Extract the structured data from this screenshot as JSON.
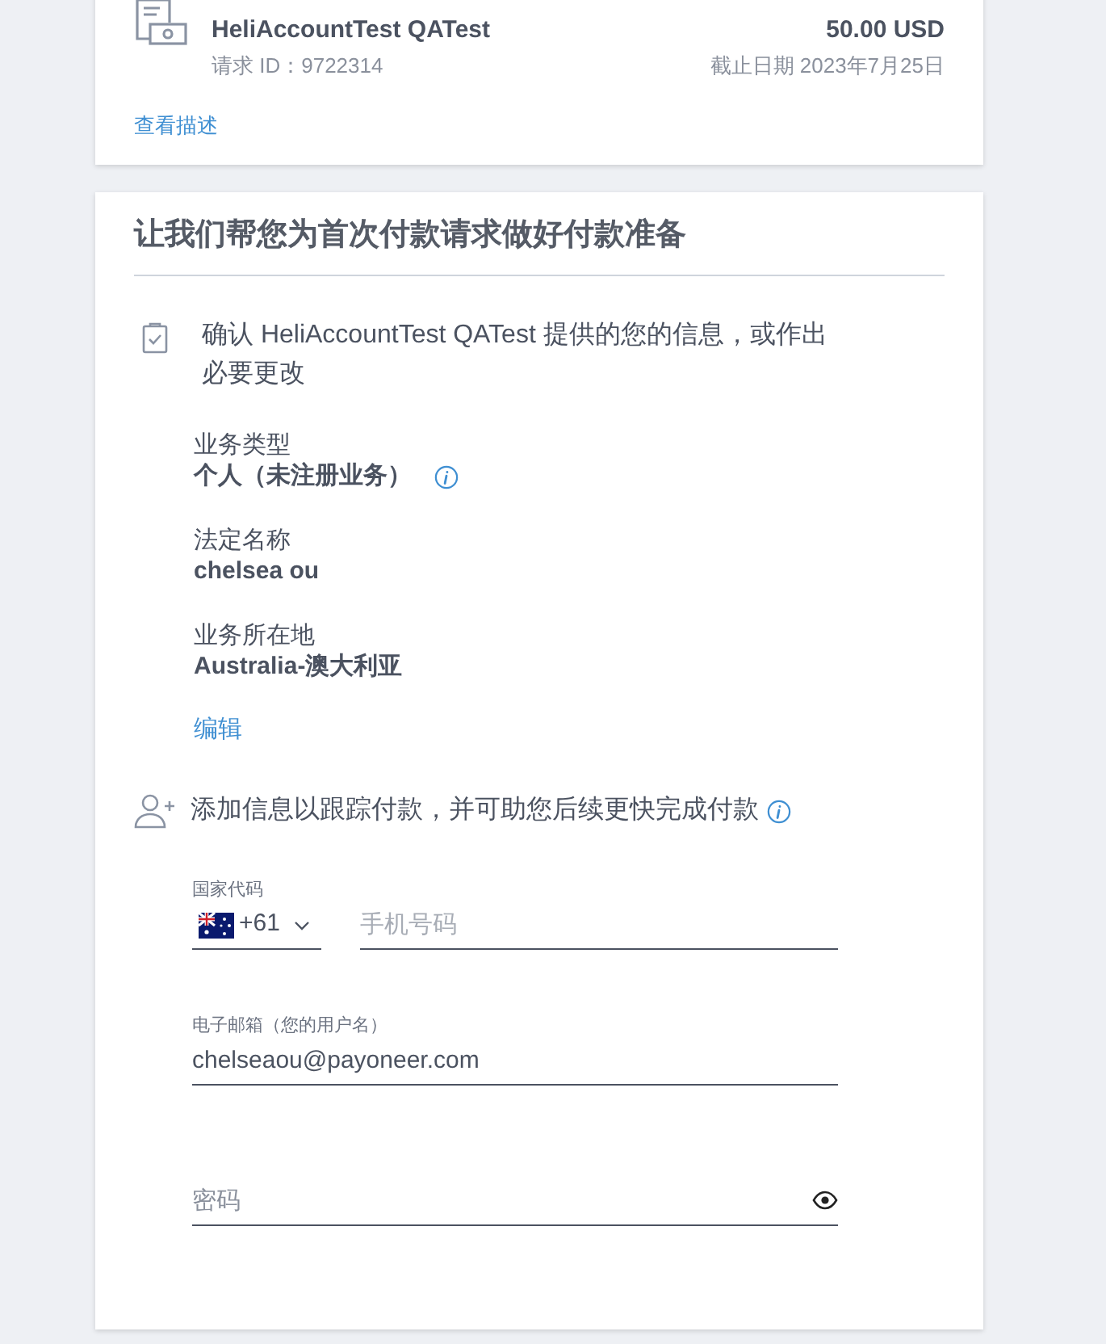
{
  "request": {
    "payer": "HeliAccountTest QATest",
    "request_id": "请求 ID：9722314",
    "amount": "50.00 USD",
    "due": "截止日期 2023年7月25日",
    "description_link": "查看描述"
  },
  "prepare": {
    "title": "让我们帮您为首次付款请求做好付款准备",
    "confirm_text": "确认 HeliAccountTest QATest 提供的您的信息，或作出必要更改",
    "details": [
      {
        "label": "业务类型",
        "value": "个人（未注册业务）",
        "info": true
      },
      {
        "label": "法定名称",
        "value": "chelsea ou",
        "info": false
      },
      {
        "label": "业务所在地",
        "value": "Australia-澳大利亚",
        "info": false
      }
    ],
    "edit_link": "编辑",
    "add_info_text": "添加信息以跟踪付款，并可助您后续更快完成付款",
    "country_code": {
      "label": "国家代码",
      "value": "+61"
    },
    "phone": {
      "placeholder": "手机号码"
    },
    "email": {
      "label": "电子邮箱（您的用户名）",
      "value": "chelseaou@payoneer.com"
    },
    "password": {
      "placeholder": "密码"
    }
  }
}
